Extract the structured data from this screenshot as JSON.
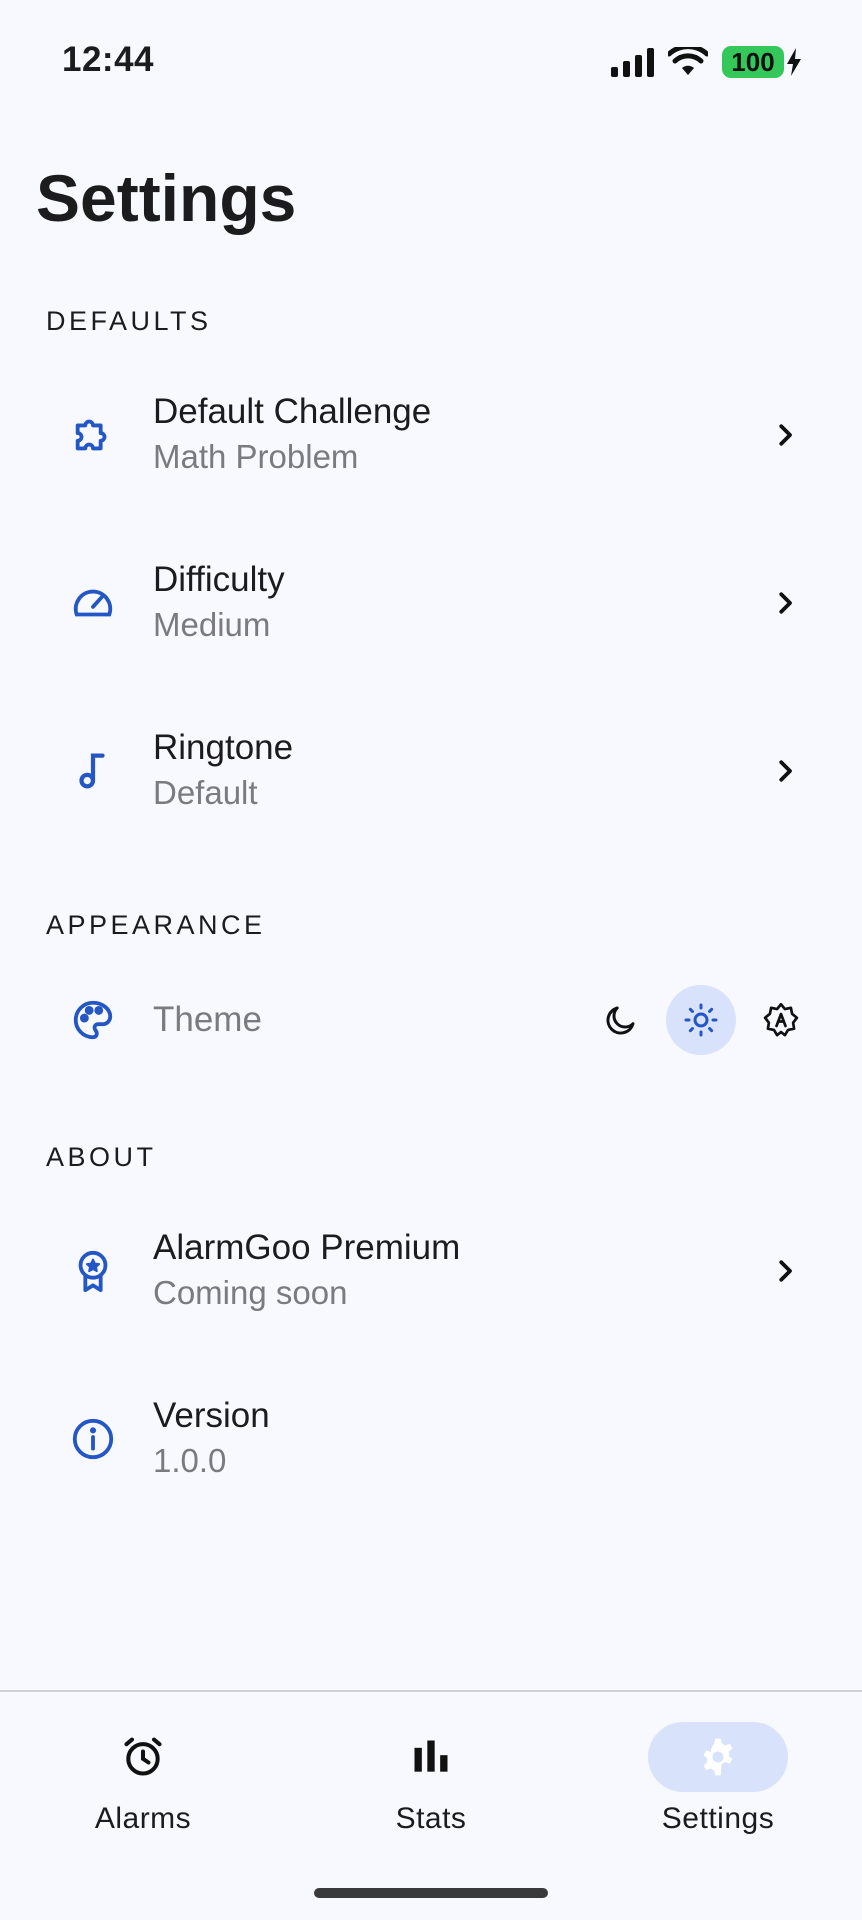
{
  "status_bar": {
    "time": "12:44",
    "battery": "100"
  },
  "page": {
    "title": "Settings"
  },
  "sections": {
    "defaults": {
      "header": "DEFAULTS",
      "items": [
        {
          "title": "Default Challenge",
          "subtitle": "Math Problem",
          "icon": "puzzle-icon"
        },
        {
          "title": "Difficulty",
          "subtitle": "Medium",
          "icon": "speedometer-icon"
        },
        {
          "title": "Ringtone",
          "subtitle": "Default",
          "icon": "music-note-icon"
        }
      ]
    },
    "appearance": {
      "header": "APPEARANCE",
      "theme_label": "Theme",
      "options": [
        {
          "icon": "moon-icon",
          "selected": false
        },
        {
          "icon": "sun-icon",
          "selected": true
        },
        {
          "icon": "auto-brightness-icon",
          "selected": false
        }
      ]
    },
    "about": {
      "header": "ABOUT",
      "items": [
        {
          "title": "AlarmGoo Premium",
          "subtitle": "Coming soon",
          "icon": "award-badge-icon"
        },
        {
          "title": "Version",
          "subtitle": "1.0.0",
          "icon": "info-icon"
        }
      ]
    }
  },
  "nav": {
    "items": [
      {
        "label": "Alarms",
        "icon": "alarm-clock-icon",
        "active": false
      },
      {
        "label": "Stats",
        "icon": "bar-chart-icon",
        "active": false
      },
      {
        "label": "Settings",
        "icon": "gear-icon",
        "active": true
      }
    ]
  },
  "colors": {
    "accent": "#2457c5",
    "background": "#f8f9fe",
    "selected_bg": "#d8e2fa",
    "battery": "#34c759",
    "subtitle": "#7a7a80"
  }
}
